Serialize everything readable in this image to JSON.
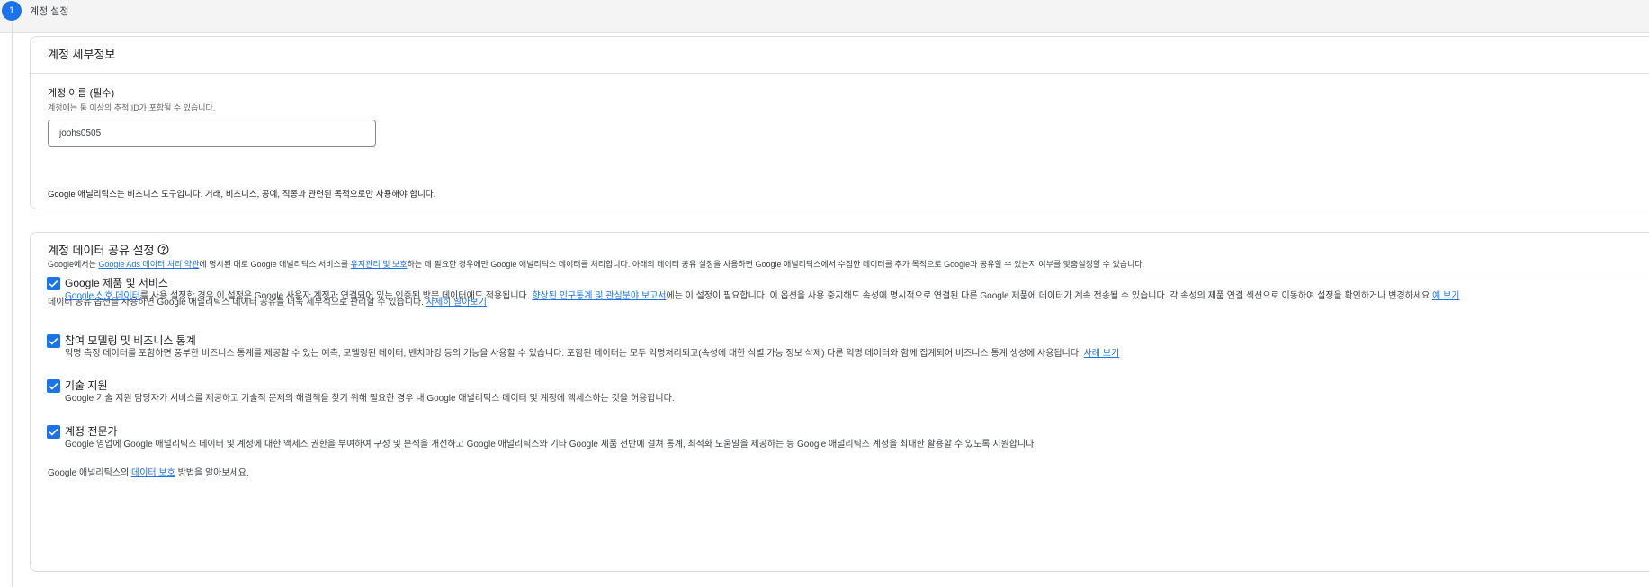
{
  "step": {
    "number": "1",
    "title": "계정 설정"
  },
  "account_details": {
    "title": "계정 세부정보",
    "name_label": "계정 이름 (필수)",
    "name_help": "계정에는 둘 이상의 추적 ID가 포함될 수 있습니다.",
    "name_value": "joohs0505",
    "business_note": "Google 애널리틱스는 비즈니스 도구입니다. 거래, 비즈니스, 공예, 직종과 관련된 목적으로만 사용해야 합니다."
  },
  "data_sharing": {
    "title": "계정 데이터 공유 설정",
    "help_icon": "help-circle-icon",
    "desc_prefix": "Google에서는 ",
    "desc_link1": "Google Ads 데이터 처리 약관",
    "desc_mid1": "에 명시된 대로 Google 애널리틱스 서비스를 ",
    "desc_link2": "유지관리 및 보호",
    "desc_suffix": "하는 데 필요한 경우에만 Google 애널리틱스 데이터를 처리합니다. 아래의 데이터 공유 설정을 사용하면 Google 애널리틱스에서 수집한 데이터를 추가 목적으로 Google과 공유할 수 있는지 여부를 맞춤설정할 수 있습니다.",
    "intro_text": "데이터 공유 옵션을 사용하면 Google 애널리틱스 데이터 공유를 더욱 세부적으로 관리할 수 있습니다. ",
    "intro_link": "자세히 알아보기",
    "options": [
      {
        "title": "Google 제품 및 서비스",
        "checked": true,
        "link1": "Google 신호 데이터",
        "text1": "를 사용 설정한 경우 이 설정은 Google 사용자 계정과 연결되어 있는 인증된 방문 데이터에도 적용됩니다. ",
        "link2": "향상된 인구통계 및 관심분야 보고서",
        "text2": "에는 이 설정이 필요합니다. 이 옵션을 사용 중지해도 속성에 명시적으로 연결된 다른 Google 제품에 데이터가 계속 전송될 수 있습니다. 각 속성의 제품 연결 섹션으로 이동하여 설정을 확인하거나 변경하세요 ",
        "link3": "예 보기"
      },
      {
        "title": "참여 모델링 및 비즈니스 통계",
        "checked": true,
        "text1": "익명 측정 데이터를 포함하면 풍부한 비즈니스 통계를 제공할 수 있는 예측, 모델링된 데이터, 벤치마킹 등의 기능을 사용할 수 있습니다. 포함된 데이터는 모두 익명처리되고(속성에 대한 식별 가능 정보 삭제) 다른 익명 데이터와 함께 집계되어 비즈니스 통계 생성에 사용됩니다. ",
        "link1": "사례 보기"
      },
      {
        "title": "기술 지원",
        "checked": true,
        "text1": "Google 기술 지원 담당자가 서비스를 제공하고 기술적 문제의 해결책을 찾기 위해 필요한 경우 내 Google 애널리틱스 데이터 및 계정에 액세스하는 것을 허용합니다."
      },
      {
        "title": "계정 전문가",
        "checked": true,
        "text1": "Google 영업에 Google 애널리틱스 데이터 및 계정에 대한 액세스 권한을 부여하여 구성 및 분석을 개선하고 Google 애널리틱스와 기타 Google 제품 전반에 걸쳐 통계, 최적화 도움말을 제공하는 등 Google 애널리틱스 계정을 최대한 활용할 수 있도록 지원합니다."
      }
    ],
    "footer_prefix": "Google 애널리틱스의 ",
    "footer_link": "데이터 보호",
    "footer_suffix": " 방법을 알아보세요."
  },
  "colors": {
    "accent": "#1a73e8",
    "border": "#dadce0",
    "header_bg": "#f4f4f4"
  }
}
